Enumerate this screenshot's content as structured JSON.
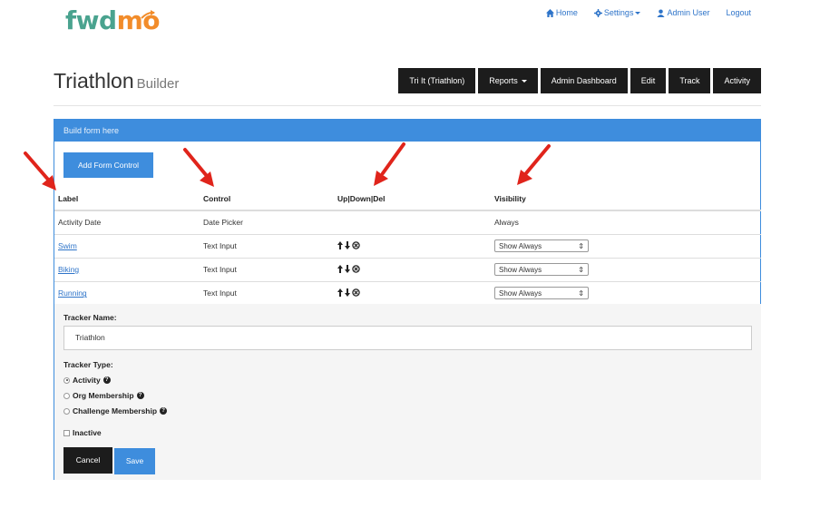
{
  "brand": {
    "logo_part1": "fwd",
    "logo_part2": "mo",
    "color_primary": "#4aa38f",
    "color_accent": "#f28c2a"
  },
  "topnav": {
    "home": "Home",
    "settings": "Settings",
    "user": "Admin User",
    "logout": "Logout"
  },
  "page": {
    "title": "Triathlon",
    "subtitle": "Builder"
  },
  "buttons": {
    "tri": "Tri It (Triathlon)",
    "reports": "Reports",
    "admin_dashboard": "Admin Dashboard",
    "edit": "Edit",
    "track": "Track",
    "activity": "Activity"
  },
  "panel": {
    "heading": "Build form here",
    "add_button": "Add Form Control"
  },
  "table": {
    "headers": {
      "label": "Label",
      "control": "Control",
      "updown": "Up|Down|Del",
      "visibility": "Visibility"
    },
    "rows": [
      {
        "label": "Activity Date",
        "control": "Date Picker",
        "visibility": "Always"
      },
      {
        "label": "Swim",
        "control": "Text Input",
        "visibility": "Show Always"
      },
      {
        "label": "Biking",
        "control": "Text Input",
        "visibility": "Show Always"
      },
      {
        "label": "Running",
        "control": "Text Input",
        "visibility": "Show Always"
      }
    ]
  },
  "form": {
    "tracker_name_label": "Tracker Name:",
    "tracker_name_value": "Triathlon",
    "tracker_type_label": "Tracker Type:",
    "types": [
      "Activity",
      "Org Membership",
      "Challenge Membership"
    ],
    "selected_type": "Activity",
    "inactive_label": "Inactive",
    "inactive_checked": false,
    "cancel": "Cancel",
    "save": "Save"
  },
  "colors": {
    "primary_blue": "#3e8ddd",
    "dark_button": "#1c1c1c",
    "annotation_red": "#e0241b"
  }
}
